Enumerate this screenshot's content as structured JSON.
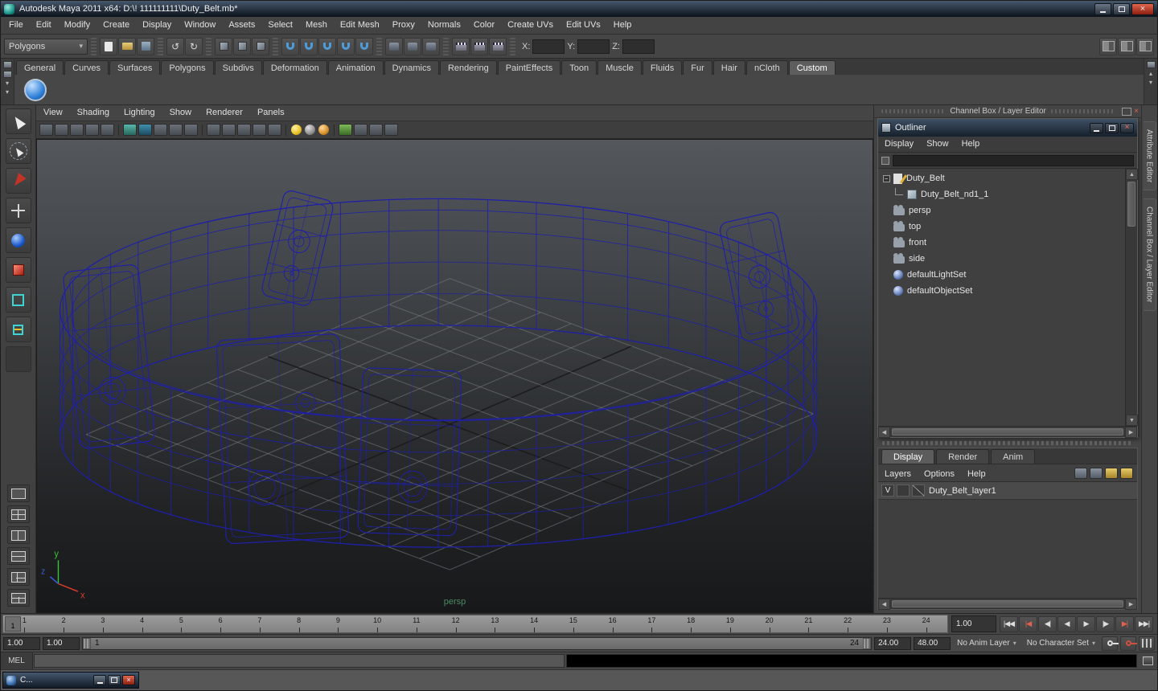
{
  "window": {
    "title": "Autodesk Maya 2011 x64: D:\\! 111111111\\Duty_Belt.mb*"
  },
  "icons": {
    "close": "×",
    "dropdown_arrow": "▾",
    "collapse": "−",
    "up_arrow": "▲",
    "down_arrow": "▼",
    "left_arrow": "◀",
    "right_arrow": "▶"
  },
  "menubar": {
    "items": [
      "File",
      "Edit",
      "Modify",
      "Create",
      "Display",
      "Window",
      "Assets",
      "Select",
      "Mesh",
      "Edit Mesh",
      "Proxy",
      "Normals",
      "Color",
      "Create UVs",
      "Edit UVs",
      "Help"
    ]
  },
  "statusline": {
    "menuset": "Polygons",
    "x_label": "X:",
    "y_label": "Y:",
    "z_label": "Z:",
    "x_value": "",
    "y_value": "",
    "z_value": ""
  },
  "shelf": {
    "tabs": [
      "General",
      "Curves",
      "Surfaces",
      "Polygons",
      "Subdivs",
      "Deformation",
      "Animation",
      "Dynamics",
      "Rendering",
      "PaintEffects",
      "Toon",
      "Muscle",
      "Fluids",
      "Fur",
      "Hair",
      "nCloth",
      "Custom"
    ],
    "active_tab": "Custom"
  },
  "panel": {
    "menus": [
      "View",
      "Shading",
      "Lighting",
      "Show",
      "Renderer",
      "Panels"
    ],
    "camera_label": "persp"
  },
  "right": {
    "header": "Channel Box / Layer Editor",
    "vertical_tabs": [
      "Attribute Editor",
      "Channel Box / Layer Editor"
    ]
  },
  "outliner": {
    "title": "Outliner",
    "menus": [
      "Display",
      "Show",
      "Help"
    ],
    "search_value": "",
    "items": [
      {
        "label": "Duty_Belt",
        "icon": "transform",
        "expander": true
      },
      {
        "label": "Duty_Belt_nd1_1",
        "icon": "mesh",
        "child": true
      },
      {
        "label": "persp",
        "icon": "camera"
      },
      {
        "label": "top",
        "icon": "camera"
      },
      {
        "label": "front",
        "icon": "camera"
      },
      {
        "label": "side",
        "icon": "camera"
      },
      {
        "label": "defaultLightSet",
        "icon": "set"
      },
      {
        "label": "defaultObjectSet",
        "icon": "set"
      }
    ]
  },
  "layer_editor": {
    "tabs": [
      "Display",
      "Render",
      "Anim"
    ],
    "active_tab": "Display",
    "menus": [
      "Layers",
      "Options",
      "Help"
    ],
    "layers": [
      {
        "visible": "V",
        "name": "Duty_Belt_layer1"
      }
    ]
  },
  "timeline": {
    "frames": [
      "1",
      "2",
      "3",
      "4",
      "5",
      "6",
      "7",
      "8",
      "9",
      "10",
      "11",
      "12",
      "13",
      "14",
      "15",
      "16",
      "17",
      "18",
      "19",
      "20",
      "21",
      "22",
      "23",
      "24"
    ],
    "current_frame": "1",
    "current_time_field": "1.00",
    "playback": [
      {
        "name": "go-to-start-button",
        "glyph": "|◀◀"
      },
      {
        "name": "step-back-key-button",
        "glyph": "|◀",
        "accent": true
      },
      {
        "name": "step-back-frame-button",
        "glyph": "◀|"
      },
      {
        "name": "play-backwards-button",
        "glyph": "◀"
      },
      {
        "name": "play-forwards-button",
        "glyph": "▶"
      },
      {
        "name": "step-forward-frame-button",
        "glyph": "|▶"
      },
      {
        "name": "step-forward-key-button",
        "glyph": "▶|",
        "accent": true
      },
      {
        "name": "go-to-end-button",
        "glyph": "▶▶|"
      }
    ]
  },
  "range": {
    "anim_start": "1.00",
    "playback_start": "1.00",
    "range_start_label": "1",
    "range_end_label": "24",
    "playback_end": "24.00",
    "anim_end": "48.00",
    "anim_layer": "No Anim Layer",
    "character_set": "No Character Set"
  },
  "command_line": {
    "label": "MEL",
    "input_value": "",
    "result_value": ""
  },
  "taskbar": {
    "minimized_title": "C..."
  }
}
